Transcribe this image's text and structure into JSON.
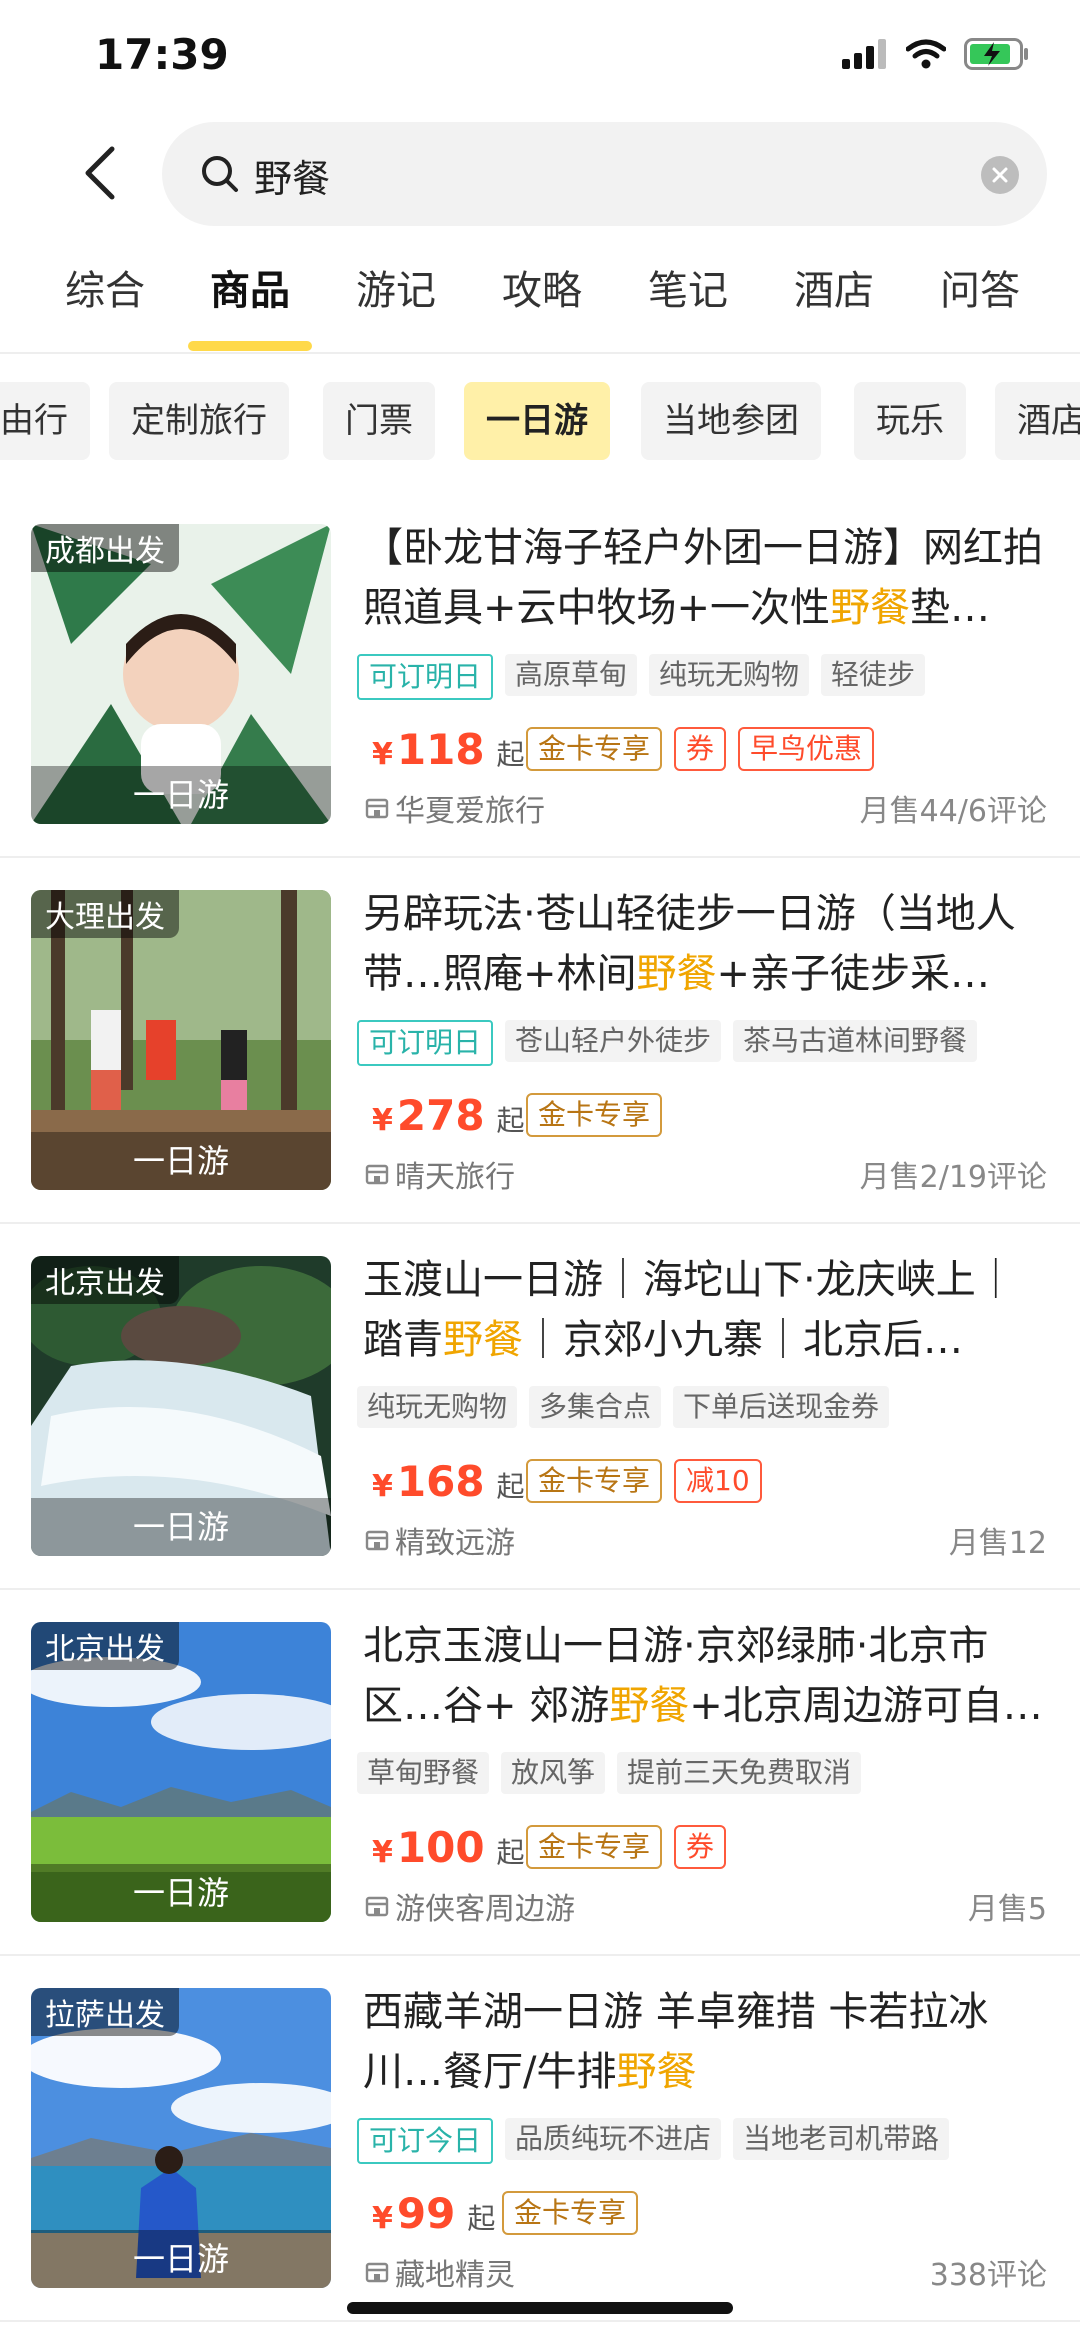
{
  "status": {
    "time": "17:39"
  },
  "search": {
    "query": "野餐"
  },
  "tabs": [
    {
      "label": "综合"
    },
    {
      "label": "商品"
    },
    {
      "label": "游记"
    },
    {
      "label": "攻略"
    },
    {
      "label": "笔记"
    },
    {
      "label": "酒店"
    },
    {
      "label": "问答"
    }
  ],
  "active_tab": "商品",
  "chips": [
    {
      "label": "由行"
    },
    {
      "label": "定制旅行"
    },
    {
      "label": "门票"
    },
    {
      "label": "一日游"
    },
    {
      "label": "当地参团"
    },
    {
      "label": "玩乐"
    },
    {
      "label": "酒店"
    }
  ],
  "active_chip": "一日游",
  "colors": {
    "accent_yellow": "#ffd94a",
    "highlight": "#f0a500",
    "price_red": "#ff4b2b",
    "tag_green": "#29b3a9"
  },
  "products": [
    {
      "origin": "成都出发",
      "caption": "一日游",
      "title_pre": "【卧龙甘海子轻户外团一日游】网红拍照道具+云中牧场+一次性",
      "title_hl": "野餐",
      "title_post": "垫…",
      "tags": [
        {
          "text": "可订明日",
          "style": "green"
        },
        {
          "text": "高原草甸",
          "style": "gray"
        },
        {
          "text": "纯玩无购物",
          "style": "gray"
        },
        {
          "text": "轻徒步",
          "style": "gray"
        }
      ],
      "currency": "¥",
      "price": "118",
      "price_suffix": "起",
      "badges": [
        {
          "text": "金卡专享",
          "style": "gold"
        },
        {
          "text": "券",
          "style": "red"
        },
        {
          "text": "早鸟优惠",
          "style": "red"
        }
      ],
      "shop": "华夏爱旅行",
      "sales": "月售44/6评论",
      "image": "nature-portrait"
    },
    {
      "origin": "大理出发",
      "caption": "一日游",
      "title_pre": "另辟玩法·苍山轻徒步一日游（当地人带…照庵+林间",
      "title_hl": "野餐",
      "title_post": "+亲子徒步采…",
      "tags": [
        {
          "text": "可订明日",
          "style": "green"
        },
        {
          "text": "苍山轻户外徒步",
          "style": "gray"
        },
        {
          "text": "茶马古道林间野餐",
          "style": "gray"
        }
      ],
      "currency": "¥",
      "price": "278",
      "price_suffix": "起",
      "badges": [
        {
          "text": "金卡专享",
          "style": "gold"
        }
      ],
      "shop": "晴天旅行",
      "sales": "月售2/19评论",
      "image": "forest-hikers"
    },
    {
      "origin": "北京出发",
      "caption": "一日游",
      "title_pre": "玉渡山一日游｜海坨山下·龙庆峡上｜踏青",
      "title_hl": "野餐",
      "title_post": "｜京郊小九寨｜北京后…",
      "tags": [
        {
          "text": "纯玩无购物",
          "style": "gray"
        },
        {
          "text": "多集合点",
          "style": "gray"
        },
        {
          "text": "下单后送现金券",
          "style": "gray"
        }
      ],
      "currency": "¥",
      "price": "168",
      "price_suffix": "起",
      "badges": [
        {
          "text": "金卡专享",
          "style": "gold"
        },
        {
          "text": "减10",
          "style": "red"
        }
      ],
      "shop": "精致远游",
      "sales": "月售12",
      "image": "waterfall"
    },
    {
      "origin": "北京出发",
      "caption": "一日游",
      "title_pre": "北京玉渡山一日游·京郊绿肺·北京市区…谷+ 郊游",
      "title_hl": "野餐",
      "title_post": "+北京周边游可自…",
      "tags": [
        {
          "text": "草甸野餐",
          "style": "gray"
        },
        {
          "text": "放风筝",
          "style": "gray"
        },
        {
          "text": "提前三天免费取消",
          "style": "gray"
        }
      ],
      "currency": "¥",
      "price": "100",
      "price_suffix": "起",
      "badges": [
        {
          "text": "金卡专享",
          "style": "gold"
        },
        {
          "text": "券",
          "style": "red"
        }
      ],
      "shop": "游侠客周边游",
      "sales": "月售5",
      "image": "meadow-sky"
    },
    {
      "origin": "拉萨出发",
      "caption": "一日游",
      "title_pre": "西藏羊湖一日游 羊卓雍措 卡若拉冰川…餐厅/牛排",
      "title_hl": "野餐",
      "title_post": "",
      "tags": [
        {
          "text": "可订今日",
          "style": "green"
        },
        {
          "text": "品质纯玩不进店",
          "style": "gray"
        },
        {
          "text": "当地老司机带路",
          "style": "gray"
        }
      ],
      "currency": "¥",
      "price": "99",
      "price_suffix": "起",
      "badges": [
        {
          "text": "金卡专享",
          "style": "gold"
        }
      ],
      "shop": "藏地精灵",
      "sales": "338评论",
      "image": "lake-woman"
    }
  ]
}
